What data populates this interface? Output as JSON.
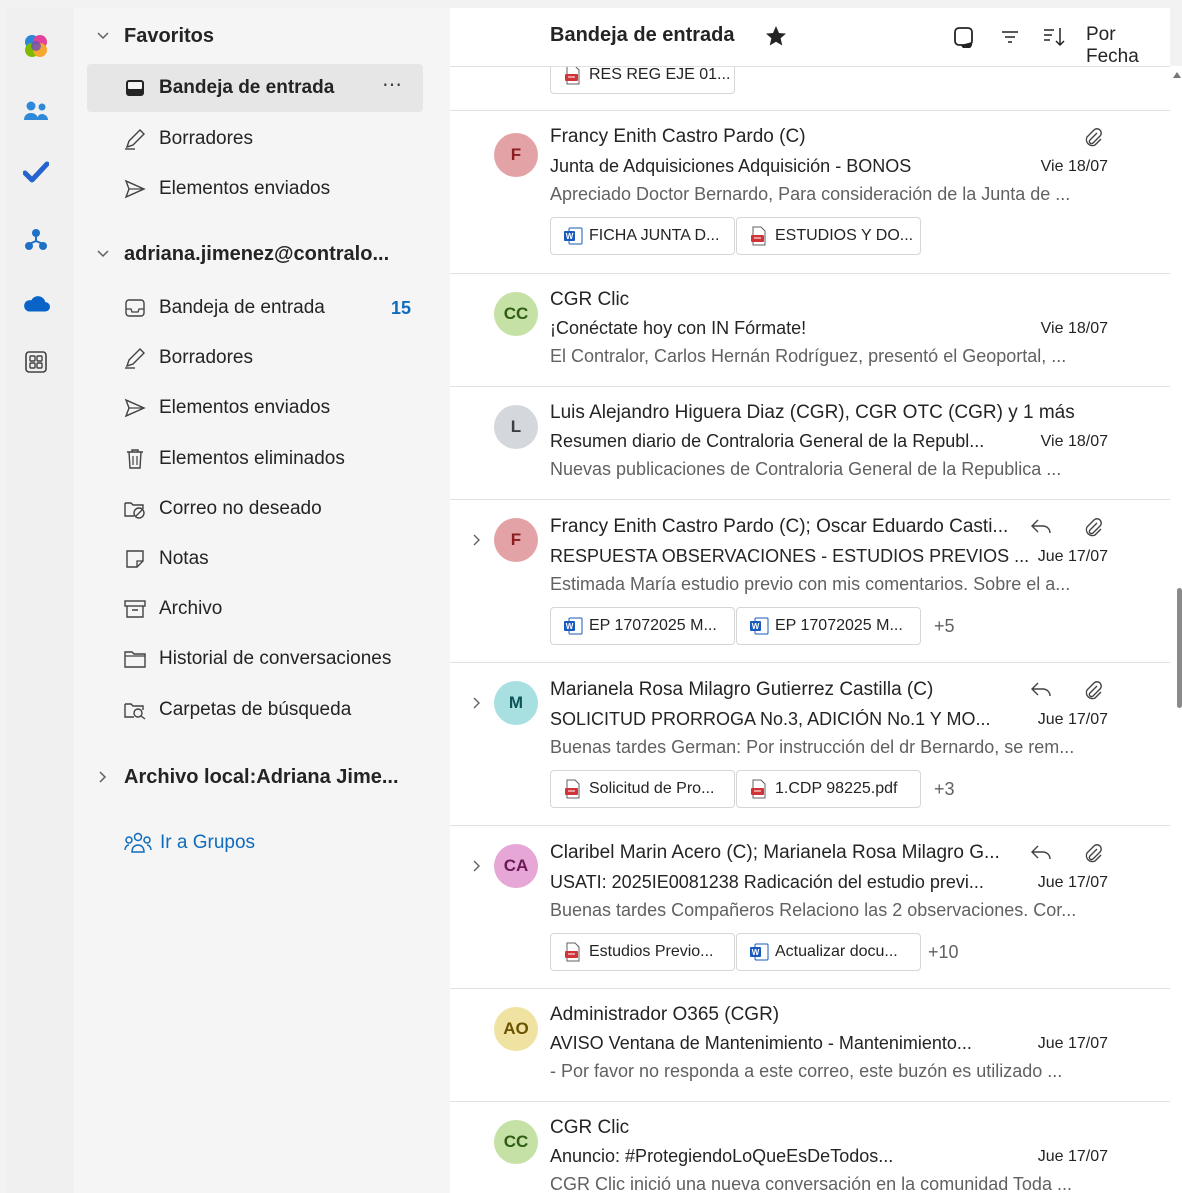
{
  "nav": {
    "favorites_label": "Favoritos",
    "favorites": [
      {
        "label": "Bandeja de entrada",
        "more": "⋯"
      },
      {
        "label": "Borradores"
      },
      {
        "label": "Elementos enviados"
      }
    ],
    "account_label": "adriana.jimenez@contralo...",
    "account_folders": [
      {
        "label": "Bandeja de entrada",
        "count": "15"
      },
      {
        "label": "Borradores"
      },
      {
        "label": "Elementos enviados"
      },
      {
        "label": "Elementos eliminados"
      },
      {
        "label": "Correo no deseado"
      },
      {
        "label": "Notas"
      },
      {
        "label": "Archivo"
      },
      {
        "label": "Historial de conversaciones"
      },
      {
        "label": "Carpetas de búsqueda"
      }
    ],
    "local_archive_label": "Archivo local:Adriana Jime...",
    "groups_link": "Ir a Grupos"
  },
  "list_header": {
    "title": "Bandeja de entrada",
    "sort_label": "Por Fecha"
  },
  "messages": [
    {
      "attachments": [
        {
          "name": "RES REG EJE 01...",
          "type": "pdf"
        }
      ]
    },
    {
      "avatar": "F",
      "avatar_bg": "#d99a9a",
      "avatar_fg": "#7a1f1f",
      "sender": "Francy Enith Castro Pardo (C)",
      "subject": "Junta de Adquisiciones Adquisición - BONOS",
      "date": "Vie 18/07",
      "preview": "Apreciado Doctor Bernardo, Para consideración de la Junta de ...",
      "attachments": [
        {
          "name": "FICHA JUNTA D...",
          "type": "word"
        },
        {
          "name": "ESTUDIOS Y DO...",
          "type": "pdf"
        }
      ]
    },
    {
      "avatar": "CC",
      "avatar_bg": "#c3e0a3",
      "avatar_fg": "#2a5a12",
      "sender": "CGR Clic",
      "subject": "¡Conéctate hoy con IN Fórmate!",
      "date": "Vie 18/07",
      "preview": "El Contralor, Carlos Hernán Rodríguez, presentó el Geoportal, ..."
    },
    {
      "avatar": "L",
      "avatar_bg": "#d4d8dc",
      "avatar_fg": "#3a3f44",
      "sender": "Luis Alejandro Higuera Diaz (CGR), CGR OTC (CGR) y 1 más",
      "subject": "Resumen diario de Contraloria General de la Republ...",
      "date": "Vie 18/07",
      "preview": "Nuevas publicaciones de Contraloria General de la Republica  ..."
    },
    {
      "avatar": "F",
      "avatar_bg": "#d99a9a",
      "avatar_fg": "#7a1f1f",
      "sender": "Francy Enith Castro Pardo (C); Oscar Eduardo Casti...",
      "subject": "RESPUESTA OBSERVACIONES - ESTUDIOS PREVIOS ...",
      "date": "Jue 17/07",
      "preview": "Estimada María estudio previo con mis comentarios. Sobre el a...",
      "attachments": [
        {
          "name": "EP 17072025 M...",
          "type": "word"
        },
        {
          "name": "EP 17072025 M...",
          "type": "word"
        }
      ],
      "more_attachments": "+5"
    },
    {
      "avatar": "M",
      "avatar_bg": "#a8dfe0",
      "avatar_fg": "#0b5457",
      "sender": "Marianela Rosa Milagro Gutierrez Castilla (C)",
      "subject": "SOLICITUD PRORROGA No.3, ADICIÓN No.1 Y MO...",
      "date": "Jue 17/07",
      "preview": "Buenas tardes German: Por instrucción del dr Bernardo, se rem...",
      "attachments": [
        {
          "name": "Solicitud de Pro...",
          "type": "pdf"
        },
        {
          "name": "1.CDP 98225.pdf",
          "type": "pdf"
        }
      ],
      "more_attachments": "+3"
    },
    {
      "avatar": "CA",
      "avatar_bg": "#e6a6d6",
      "avatar_fg": "#6b1a57",
      "sender": "Claribel Marin Acero (C); Marianela Rosa Milagro G...",
      "subject": "USATI: 2025IE0081238 Radicación del estudio previ...",
      "date": "Jue 17/07",
      "preview": "Buenas tardes Compañeros Relaciono las 2 observaciones. Cor...",
      "attachments": [
        {
          "name": "Estudios Previo...",
          "type": "pdf"
        },
        {
          "name": "Actualizar docu...",
          "type": "word"
        }
      ],
      "more_attachments": "+10"
    },
    {
      "avatar": "AO",
      "avatar_bg": "#f0e2a0",
      "avatar_fg": "#6a5200",
      "sender": "Administrador O365 (CGR)",
      "subject": "AVISO Ventana de Mantenimiento - Mantenimiento...",
      "date": "Jue 17/07",
      "preview": "- Por favor no responda a este correo, este buzón es utilizado ..."
    },
    {
      "avatar": "CC",
      "avatar_bg": "#c3e0a3",
      "avatar_fg": "#2a5a12",
      "sender": "CGR Clic",
      "subject": "Anuncio: #ProtegiendoLoQueEsDeTodos...",
      "date": "Jue 17/07",
      "preview": "CGR Clic inició una nueva conversación en la comunidad Toda ..."
    }
  ],
  "colors": {
    "accent": "#0f6cbd",
    "pdf": "#d13438",
    "word": "#185abd"
  },
  "icons": {
    "rail": [
      "copilot-icon",
      "people-icon",
      "todo-check-icon",
      "org-explorer-icon",
      "onedrive-cloud-icon",
      "apps-icon"
    ]
  }
}
